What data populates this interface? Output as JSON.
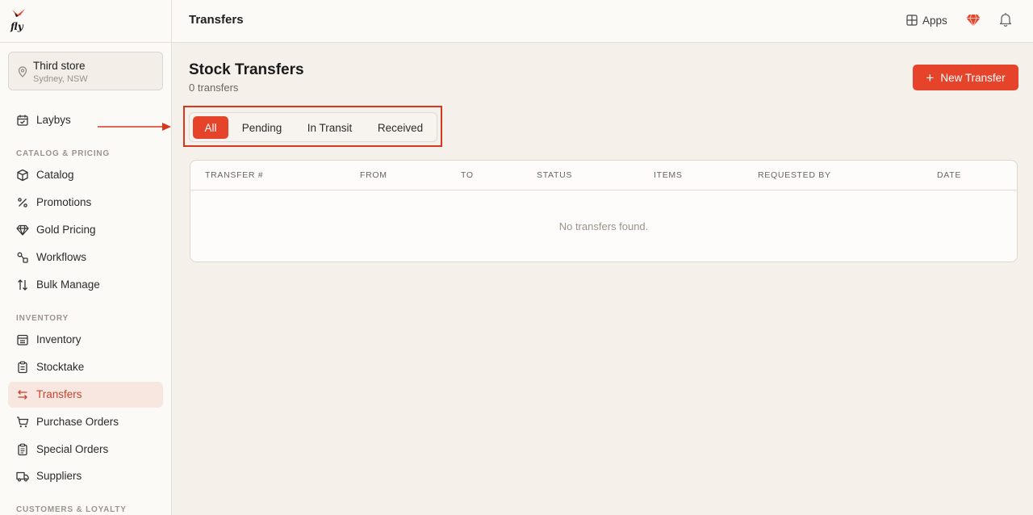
{
  "app": {
    "logo_text": "fly"
  },
  "store": {
    "name": "Third store",
    "location": "Sydney, NSW"
  },
  "sidebar": {
    "top_items": [
      {
        "label": "Laybys",
        "icon": "calendar-check-icon"
      }
    ],
    "sections": [
      {
        "title": "CATALOG & PRICING",
        "items": [
          {
            "label": "Catalog",
            "icon": "cube-icon"
          },
          {
            "label": "Promotions",
            "icon": "percent-icon"
          },
          {
            "label": "Gold Pricing",
            "icon": "diamond-icon"
          },
          {
            "label": "Workflows",
            "icon": "workflow-icon"
          },
          {
            "label": "Bulk Manage",
            "icon": "sort-arrows-icon"
          }
        ]
      },
      {
        "title": "INVENTORY",
        "items": [
          {
            "label": "Inventory",
            "icon": "archive-icon"
          },
          {
            "label": "Stocktake",
            "icon": "clipboard-icon"
          },
          {
            "label": "Transfers",
            "icon": "transfer-arrows-icon",
            "active": true
          },
          {
            "label": "Purchase Orders",
            "icon": "cart-icon"
          },
          {
            "label": "Special Orders",
            "icon": "clipboard-list-icon"
          },
          {
            "label": "Suppliers",
            "icon": "truck-icon"
          }
        ]
      },
      {
        "title": "CUSTOMERS & LOYALTY",
        "items": []
      }
    ]
  },
  "header": {
    "title": "Transfers",
    "apps_label": "Apps"
  },
  "main": {
    "title": "Stock Transfers",
    "subtitle": "0 transfers",
    "new_button_label": "New Transfer",
    "tabs": [
      {
        "label": "All",
        "active": true
      },
      {
        "label": "Pending"
      },
      {
        "label": "In Transit"
      },
      {
        "label": "Received"
      }
    ],
    "table": {
      "columns": [
        "TRANSFER #",
        "FROM",
        "TO",
        "STATUS",
        "ITEMS",
        "REQUESTED BY",
        "DATE"
      ],
      "empty_message": "No transfers found."
    }
  },
  "colors": {
    "accent": "#e5442b",
    "active_bg": "#f8e7e0",
    "annotation": "#d6371f"
  }
}
